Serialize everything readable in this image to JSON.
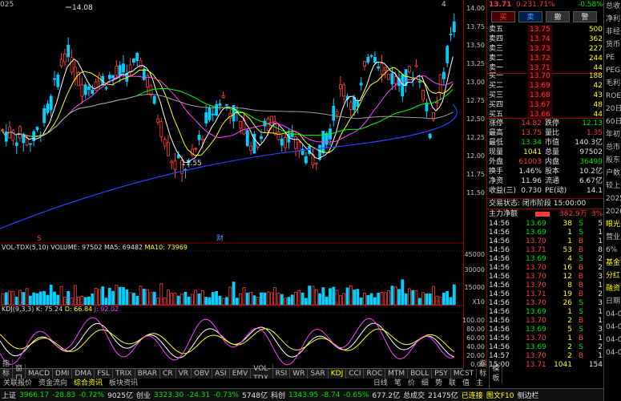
{
  "top_header": {
    "price": "13.71",
    "change": "0.23",
    "pct": "1.71%",
    "right_pct": "-0.58%"
  },
  "trade_buttons": [
    "买",
    "卖",
    "撤",
    "警"
  ],
  "chart": {
    "high_label": "14.08",
    "low_label": "11.55",
    "year_label": "025",
    "price_ticks": [
      "14.00",
      "13.75",
      "13.50",
      "13.25",
      "13.00",
      "12.75",
      "12.50",
      "12.25",
      "12.00",
      "11.75",
      "11.50"
    ],
    "volume_header": {
      "name": "VOL-TDX(5,10)",
      "volume": "VOLUME: 97502",
      "ma5": "MA5: 69482",
      "ma10": "MA10: 73969"
    },
    "volume_ticks": [
      "45000",
      "30000",
      "15000",
      "X10"
    ],
    "kdj_header": {
      "name": "KDJ(9,3,3)",
      "k": "K: 75.24",
      "d": "D: 66.84",
      "j": "J: 92.02"
    },
    "kdj_ticks": [
      "100.00",
      "80.00",
      "60.00",
      "40.00",
      "20.00",
      "0.00"
    ],
    "events": {
      "s_marker": "S",
      "cai_marker": "财",
      "x_label_4": "4"
    }
  },
  "order_book": {
    "sells": [
      {
        "label": "卖五",
        "price": "13.75",
        "vol": "500"
      },
      {
        "label": "卖四",
        "price": "13.74",
        "vol": "362"
      },
      {
        "label": "卖三",
        "price": "13.73",
        "vol": "227"
      },
      {
        "label": "卖二",
        "price": "13.72",
        "vol": "244"
      },
      {
        "label": "卖一",
        "price": "13.71",
        "vol": "44"
      }
    ],
    "buys": [
      {
        "label": "买一",
        "price": "13.70",
        "vol": "188"
      },
      {
        "label": "买二",
        "price": "13.69",
        "vol": "42"
      },
      {
        "label": "买三",
        "price": "13.68",
        "vol": "43"
      },
      {
        "label": "买四",
        "price": "13.67",
        "vol": "48"
      },
      {
        "label": "买五",
        "price": "13.66",
        "vol": "44"
      }
    ]
  },
  "stats": [
    {
      "l1": "涨停",
      "v1": "14.82",
      "l2": "跌停",
      "v2": "12.13"
    },
    {
      "l1": "最高",
      "v1": "13.75",
      "l2": "量比",
      "v2": "1.35"
    },
    {
      "l1": "最低",
      "v1": "13.34",
      "l2": "市值",
      "v2": "140.3亿"
    },
    {
      "l1": "现量",
      "v1": "1041",
      "l2": "总量",
      "v2": "97502"
    },
    {
      "l1": "外盘",
      "v1": "61003",
      "l2": "内盘",
      "v2": "36499"
    },
    {
      "l1": "换手",
      "v1": "1.46%",
      "l2": "股本",
      "v2": "10.2亿"
    },
    {
      "l1": "净资",
      "v1": "11.96",
      "l2": "流通",
      "v2": "6.67亿"
    },
    {
      "l1": "收益(三)",
      "v1": "0.730",
      "l2": "PE(动)",
      "v2": "14.1"
    }
  ],
  "trade_status": "交易状态: 闭市阶段  15:00:00",
  "main_flow": {
    "label": "主力净额",
    "value": "382.9万",
    "pct": "3%"
  },
  "ticks": [
    {
      "time": "14:56",
      "price": "13.69",
      "vol": "38",
      "side": "S",
      "n": "5"
    },
    {
      "time": "14:56",
      "price": "13.69",
      "vol": "1",
      "side": "S",
      "n": "1"
    },
    {
      "time": "14:56",
      "price": "13.70",
      "vol": "1",
      "side": "B",
      "n": "1"
    },
    {
      "time": "14:56",
      "price": "13.71",
      "vol": "53",
      "side": "B",
      "n": "8"
    },
    {
      "time": "14:56",
      "price": "13.69",
      "vol": "4",
      "side": "S",
      "n": "2"
    },
    {
      "time": "14:56",
      "price": "13.70",
      "vol": "16",
      "side": "B",
      "n": "2"
    },
    {
      "time": "14:56",
      "price": "13.70",
      "vol": "12",
      "side": "B",
      "n": "3"
    },
    {
      "time": "14:56",
      "price": "13.70",
      "vol": "8",
      "side": "B",
      "n": "1"
    },
    {
      "time": "14:56",
      "price": "13.71",
      "vol": "19",
      "side": "B",
      "n": "2"
    },
    {
      "time": "14:56",
      "price": "13.70",
      "vol": "26",
      "side": "S",
      "n": "3"
    },
    {
      "time": "14:56",
      "price": "13.69",
      "vol": "1",
      "side": "S",
      "n": "1"
    },
    {
      "time": "14:56",
      "price": "13.70",
      "vol": "2",
      "side": "B",
      "n": "1"
    },
    {
      "time": "14:56",
      "price": "13.69",
      "vol": "5",
      "side": "S",
      "n": "3"
    },
    {
      "time": "14:56",
      "price": "13.70",
      "vol": "1",
      "side": "B",
      "n": "1"
    },
    {
      "time": "14:56",
      "price": "13.69",
      "vol": "2",
      "side": "S",
      "n": "2"
    },
    {
      "time": "14:57",
      "price": "13.70",
      "vol": "2",
      "side": "B",
      "n": "1"
    },
    {
      "time": "15:00",
      "price": "13.71",
      "vol": "1041",
      "side": "",
      "n": "154"
    }
  ],
  "right_strip": [
    "总收",
    "净利",
    "非经",
    "货币",
    "PE",
    "PEG",
    "毛利",
    "ROE",
    "20日",
    "60日",
    "年初",
    "总市",
    "股东",
    "户数",
    "较上",
    "2025",
    "2026",
    "眼光",
    "营业",
    "6%",
    "基金",
    "分红",
    "融资",
    "日期",
    "04-0",
    "04-0",
    "04-0",
    "04-0"
  ],
  "indicator_tabs": [
    "指标A",
    "窗口",
    "MACD",
    "DMI",
    "DMA",
    "FSL",
    "TRIX",
    "BRAR",
    "CR",
    "VR",
    "OBV",
    "ASI",
    "EMV",
    "VOL-TDX",
    "RSI",
    "WR",
    "SAR",
    "KDJ",
    "CCI",
    "ROC",
    "MTM",
    "BOLL",
    "PSY",
    "MCST",
    "指标B",
    "模板"
  ],
  "sub_tabs": [
    {
      "label": "关联报价",
      "color": "#c0c0c0"
    },
    {
      "label": "资金流向",
      "color": "#c0c0c0"
    },
    {
      "label": "综合资讯",
      "color": "#ffff00"
    },
    {
      "label": "板块资讯",
      "color": "#c0c0c0"
    },
    {
      "label": "日线",
      "color": "#c0c0c0"
    },
    {
      "label": "笔",
      "color": "#c0c0c0"
    },
    {
      "label": "价",
      "color": "#c0c0c0"
    },
    {
      "label": "细",
      "color": "#c0c0c0"
    },
    {
      "label": "势",
      "color": "#c0c0c0"
    },
    {
      "label": "联",
      "color": "#c0c0c0"
    },
    {
      "label": "值",
      "color": "#c0c0c0"
    },
    {
      "label": "主",
      "color": "#c0c0c0"
    }
  ],
  "status_bar": {
    "sh_label": "上证",
    "sh_val": "3966.17",
    "sh_chg": "-28.83",
    "sh_pct": "-0.72%",
    "sh_amt": "9025亿",
    "cy_label": "创业",
    "cy_val": "3323.30",
    "cy_chg": "-24.31",
    "cy_pct": "-0.73%",
    "cy_amt": "5748亿",
    "kc_label": "科创",
    "kc_val": "1343.95",
    "kc_chg": "-8.74",
    "kc_pct": "-0.65%",
    "kc_amt": "677.2亿",
    "total_label": "总成交",
    "total_val": "21475亿",
    "conn": "已连接",
    "f10": "图文F10",
    "notes": "侧边栏"
  }
}
